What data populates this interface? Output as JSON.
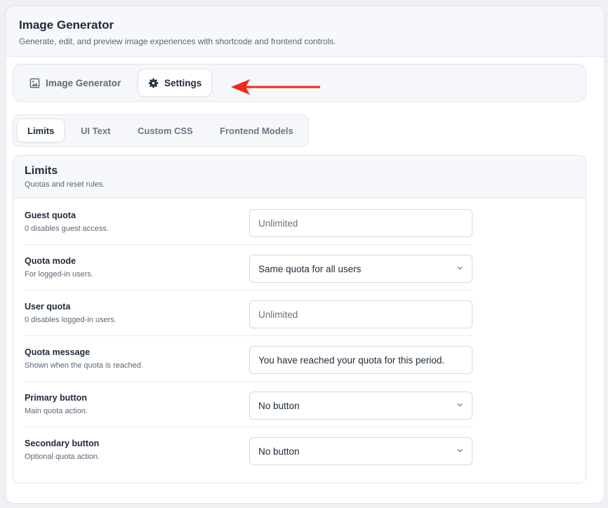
{
  "header": {
    "title": "Image Generator",
    "subtitle": "Generate, edit, and preview image experiences with shortcode and frontend controls."
  },
  "nav": {
    "items": [
      {
        "label": "Image Generator",
        "icon": "image-icon"
      },
      {
        "label": "Settings",
        "icon": "gear-icon",
        "active": true
      }
    ]
  },
  "subtabs": {
    "items": [
      {
        "label": "Limits",
        "active": true
      },
      {
        "label": "UI Text"
      },
      {
        "label": "Custom CSS"
      },
      {
        "label": "Frontend Models"
      }
    ]
  },
  "section": {
    "title": "Limits",
    "description": "Quotas and reset rules."
  },
  "fields": [
    {
      "label": "Guest quota",
      "hint": "0 disables guest access.",
      "type": "input",
      "value": "",
      "placeholder": "Unlimited"
    },
    {
      "label": "Quota mode",
      "hint": "For logged-in users.",
      "type": "select",
      "value": "Same quota for all users"
    },
    {
      "label": "User quota",
      "hint": "0 disables logged-in users.",
      "type": "input",
      "value": "",
      "placeholder": "Unlimited"
    },
    {
      "label": "Quota message",
      "hint": "Shown when the quota is reached.",
      "type": "input",
      "value": "You have reached your quota for this period."
    },
    {
      "label": "Primary button",
      "hint": "Main quota action.",
      "type": "select",
      "value": "No button"
    },
    {
      "label": "Secondary button",
      "hint": "Optional quota action.",
      "type": "select",
      "value": "No button"
    }
  ],
  "colors": {
    "annotation_arrow": "#ee2a1b",
    "accent_text": "#1e2a3b"
  }
}
